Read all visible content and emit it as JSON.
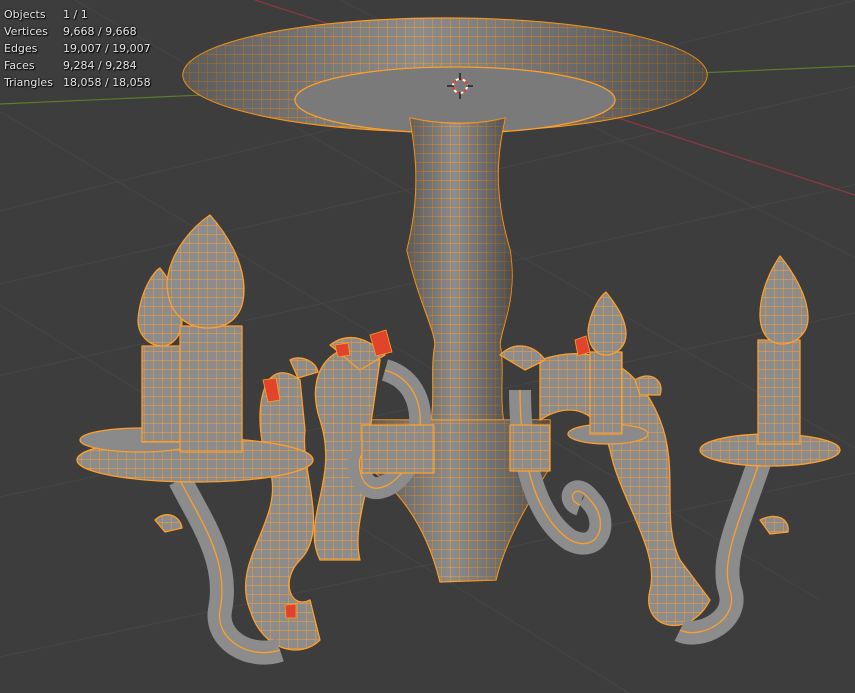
{
  "overlay": {
    "stats": [
      {
        "label": "Objects",
        "value": "1 / 1"
      },
      {
        "label": "Vertices",
        "value": "9,668 / 9,668"
      },
      {
        "label": "Edges",
        "value": "19,007 / 19,007"
      },
      {
        "label": "Faces",
        "value": "9,284 / 9,284"
      },
      {
        "label": "Triangles",
        "value": "18,058 / 18,058"
      }
    ]
  },
  "colors": {
    "background": "#3d3d3d",
    "grid": "#464646",
    "x_axis": "#8a3a45",
    "y_axis": "#5e7a2a",
    "mesh_fill": "#8c8c8c",
    "wire_selected": "#ff9f2a",
    "active_face": "#e0442a"
  },
  "icons": {
    "cursor": "3d-cursor-icon"
  }
}
